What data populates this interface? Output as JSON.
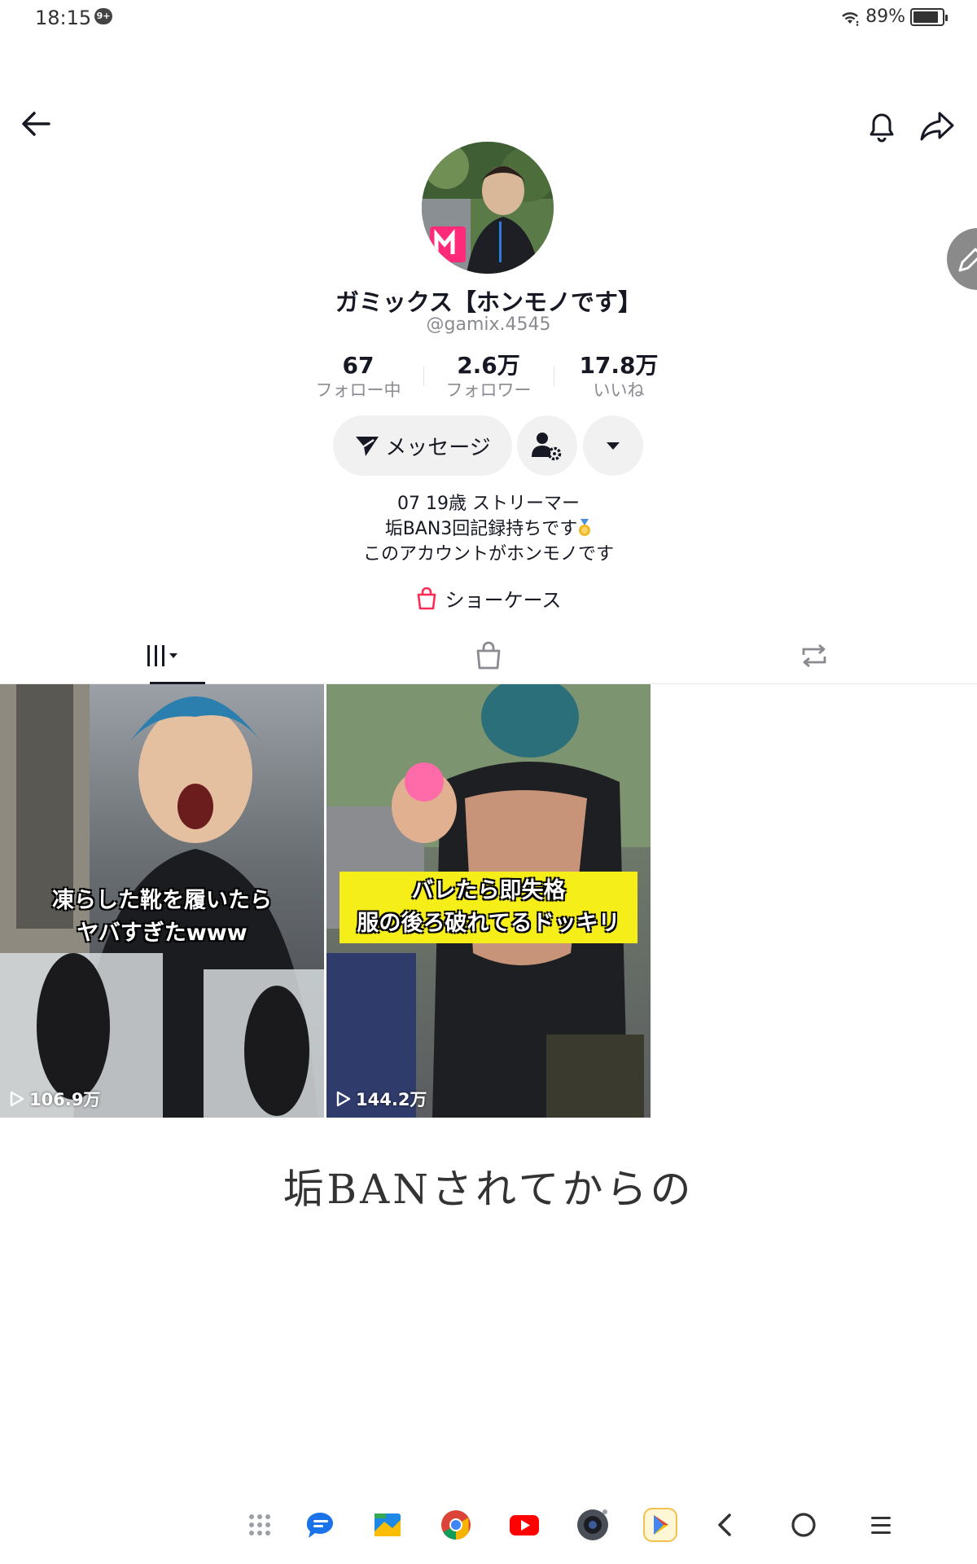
{
  "status_bar": {
    "time": "18:15",
    "notification_badge": "9+",
    "battery": "89%",
    "battery_level": 0.89
  },
  "profile": {
    "display_name": "ガミックス【ホンモノです】",
    "username": "@gamix.4545",
    "stats": [
      {
        "value": "67",
        "label": "フォロー中"
      },
      {
        "value": "2.6万",
        "label": "フォロワー"
      },
      {
        "value": "17.8万",
        "label": "いいね"
      }
    ],
    "message_button": "メッセージ",
    "bio_lines": [
      "07 19歳 ストリーマー",
      "垢BAN3回記録持ちです",
      "このアカウントがホンモノです"
    ],
    "showcase": "ショーケース"
  },
  "tabs": [
    {
      "icon": "videos-grid-icon",
      "active": true
    },
    {
      "icon": "shopping-bag-icon",
      "active": false
    },
    {
      "icon": "repost-icon",
      "active": false
    }
  ],
  "videos": [
    {
      "caption_lines": [
        "凍らした靴を履いたら",
        "ヤバすぎたwww"
      ],
      "views": "106.9万"
    },
    {
      "caption_lines": [
        "バレたら即失格",
        "服の後ろ破れてるドッキリ"
      ],
      "views": "144.2万"
    }
  ],
  "banner_text": "垢BANされてからの",
  "colors": {
    "accent": "#fe2c55",
    "text_primary": "#161823",
    "text_secondary": "#8a8b91",
    "button_bg": "#f1f1f2",
    "caption_yellow": "#f6ee19"
  },
  "dock": [
    "app-drawer-icon",
    "messages-icon",
    "files-icon",
    "chrome-icon",
    "youtube-icon",
    "camera-icon",
    "play-store-icon",
    "back-icon",
    "home-icon",
    "menu-icon"
  ]
}
